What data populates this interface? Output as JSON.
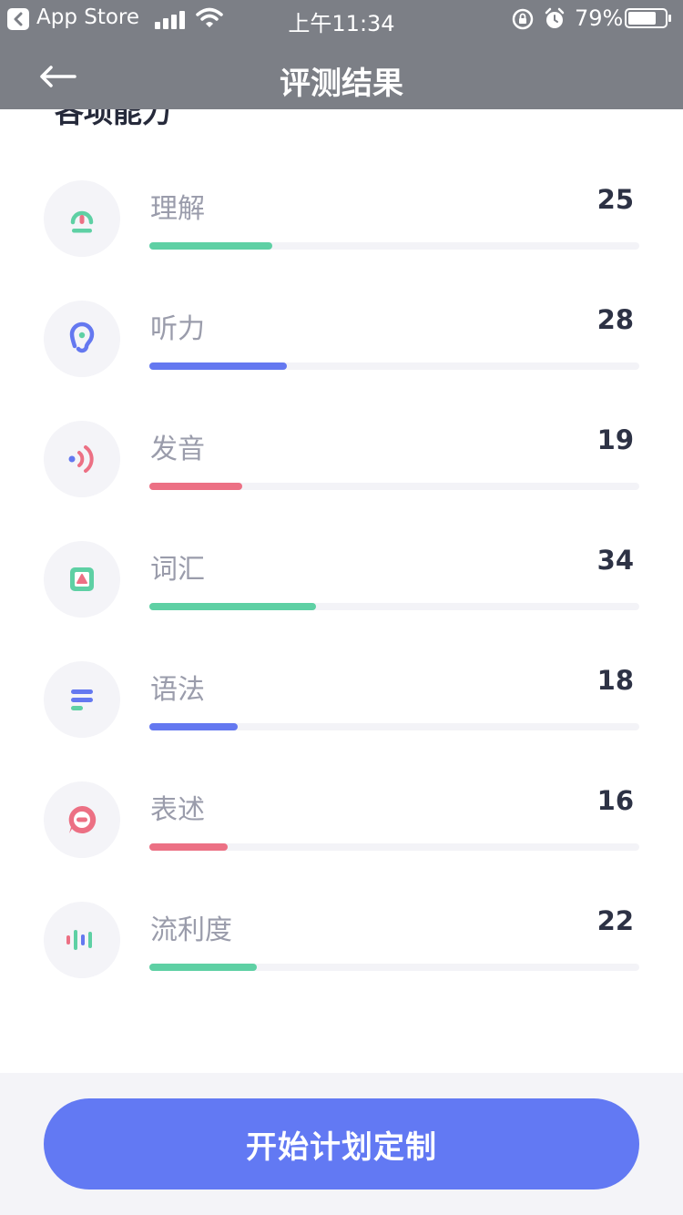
{
  "status_bar": {
    "back_app_label": "App Store",
    "time": "上午11:34",
    "battery": "79%"
  },
  "nav": {
    "title": "评测结果",
    "back_icon": "arrow-left-icon"
  },
  "section": {
    "title": "各项能力"
  },
  "colors": {
    "green": "#5ed0a4",
    "blue": "#6478f0",
    "pink": "#ec7084",
    "cta": "#6279f3"
  },
  "abilities": [
    {
      "label": "理解",
      "score": "25",
      "fill_fraction": 0.25,
      "color": "#5ed0a4",
      "icon": "comprehension-icon"
    },
    {
      "label": "听力",
      "score": "28",
      "fill_fraction": 0.28,
      "color": "#6478f0",
      "icon": "ear-icon"
    },
    {
      "label": "发音",
      "score": "19",
      "fill_fraction": 0.19,
      "color": "#ec7084",
      "icon": "sound-wave-icon"
    },
    {
      "label": "词汇",
      "score": "34",
      "fill_fraction": 0.34,
      "color": "#5ed0a4",
      "icon": "vocabulary-card-icon"
    },
    {
      "label": "语法",
      "score": "18",
      "fill_fraction": 0.18,
      "color": "#6478f0",
      "icon": "lines-icon"
    },
    {
      "label": "表述",
      "score": "16",
      "fill_fraction": 0.16,
      "color": "#ec7084",
      "icon": "speech-bubble-icon"
    },
    {
      "label": "流利度",
      "score": "22",
      "fill_fraction": 0.22,
      "color": "#5ed0a4",
      "icon": "audio-bars-icon"
    }
  ],
  "footer": {
    "cta_label": "开始计划定制"
  }
}
